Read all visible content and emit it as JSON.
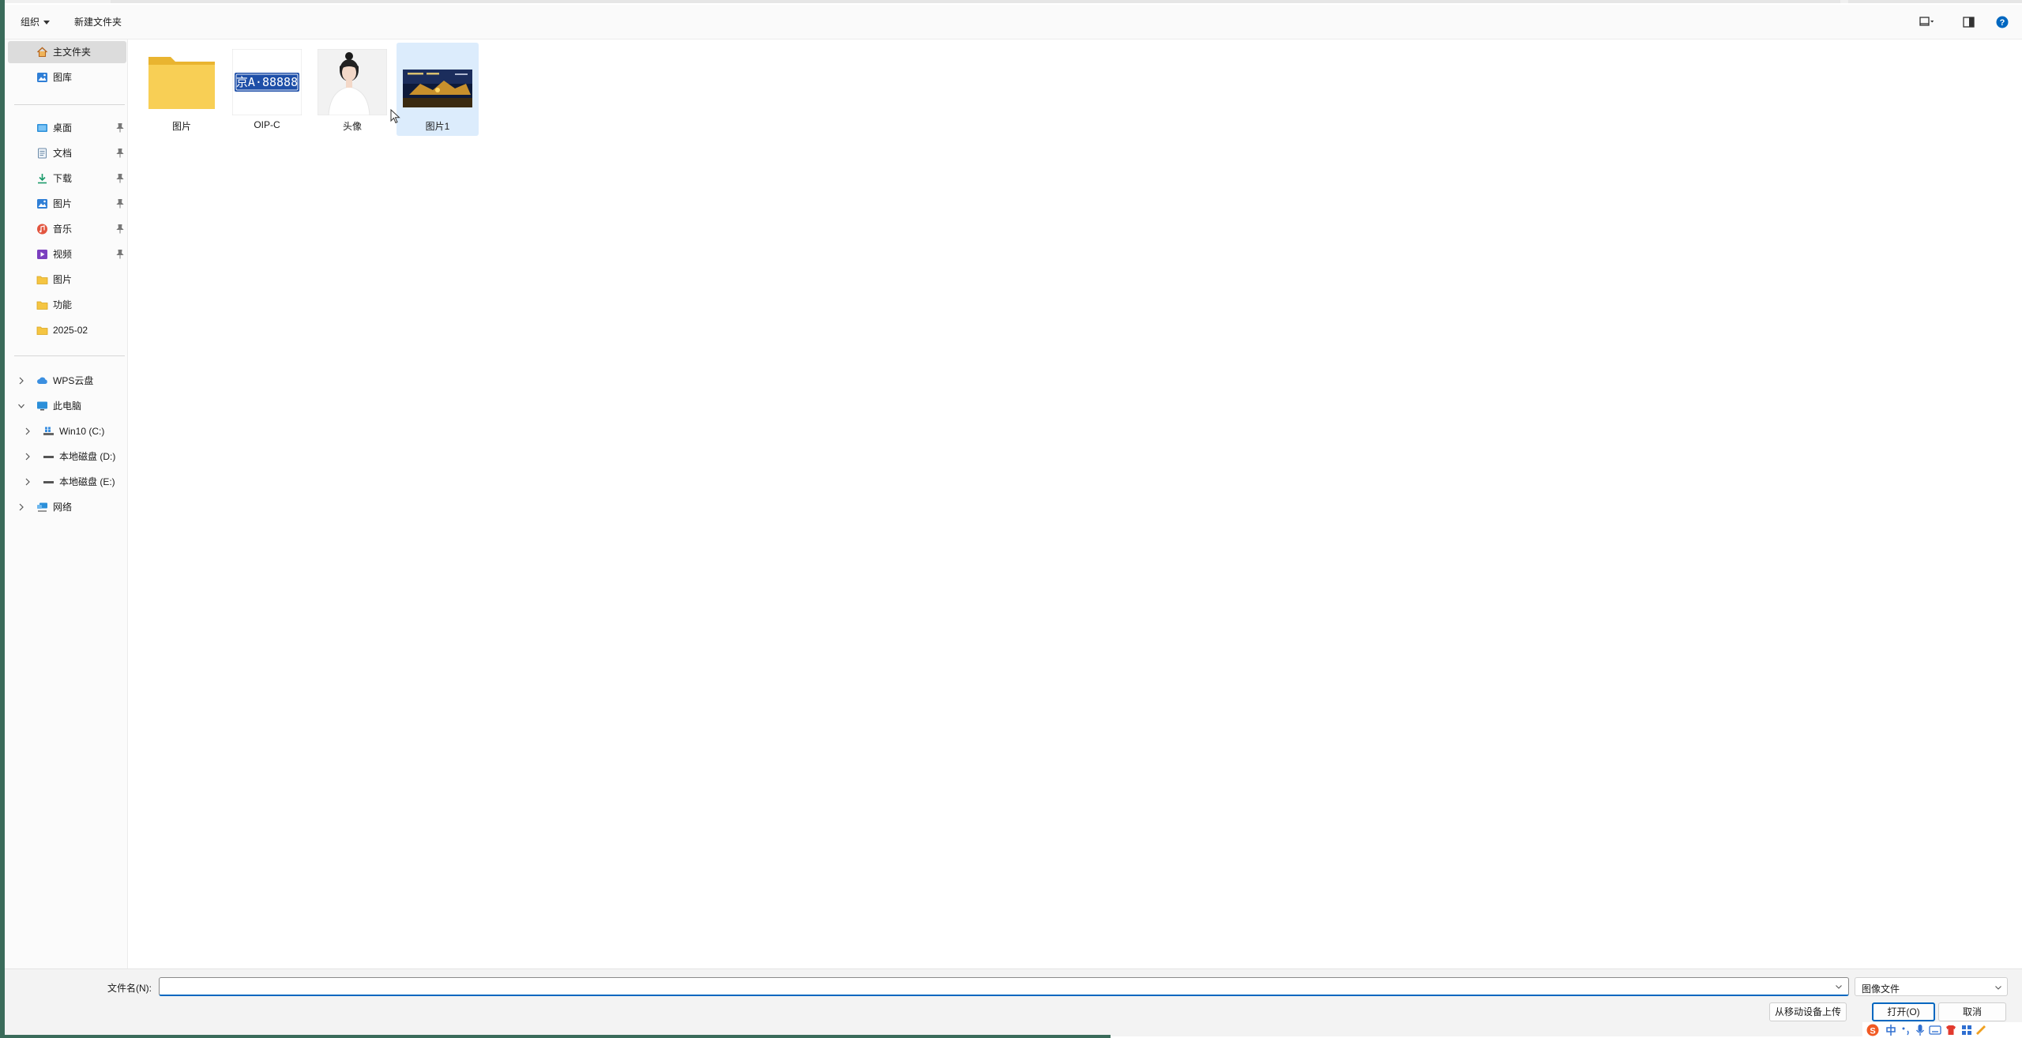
{
  "toolbar": {
    "organize_label": "组织",
    "new_folder_label": "新建文件夹"
  },
  "sidebar": {
    "home": "主文件夹",
    "gallery": "图库",
    "quick_access": [
      {
        "label": "桌面",
        "icon": "desktop-icon",
        "pinned": true
      },
      {
        "label": "文档",
        "icon": "document-icon",
        "pinned": true
      },
      {
        "label": "下载",
        "icon": "download-icon",
        "pinned": true
      },
      {
        "label": "图片",
        "icon": "pictures-icon",
        "pinned": true
      },
      {
        "label": "音乐",
        "icon": "music-icon",
        "pinned": true
      },
      {
        "label": "视频",
        "icon": "video-icon",
        "pinned": true
      },
      {
        "label": "图片",
        "icon": "folder-icon",
        "pinned": false
      },
      {
        "label": "功能",
        "icon": "folder-icon",
        "pinned": false
      },
      {
        "label": "2025-02",
        "icon": "folder-icon",
        "pinned": false
      }
    ],
    "tree": [
      {
        "label": "WPS云盘",
        "icon": "cloud-icon",
        "expanded": false
      },
      {
        "label": "此电脑",
        "icon": "computer-icon",
        "expanded": true
      },
      {
        "label": "Win10 (C:)",
        "icon": "windows-drive-icon",
        "expanded": false
      },
      {
        "label": "本地磁盘 (D:)",
        "icon": "drive-icon",
        "expanded": false
      },
      {
        "label": "本地磁盘 (E:)",
        "icon": "drive-icon",
        "expanded": false
      },
      {
        "label": "网络",
        "icon": "network-icon",
        "expanded": false
      }
    ]
  },
  "files": [
    {
      "name": "图片",
      "kind": "folder"
    },
    {
      "name": "OIP-C",
      "kind": "image-plate",
      "plate_text": "京A·88888"
    },
    {
      "name": "头像",
      "kind": "image-portrait"
    },
    {
      "name": "图片1",
      "kind": "image-night",
      "selected": true
    }
  ],
  "footer": {
    "filename_label": "文件名(N):",
    "filename_value": "",
    "file_type": "图像文件",
    "upload_label": "从移动设备上传",
    "open_label": "打开(O)",
    "cancel_label": "取消"
  },
  "colors": {
    "accent": "#0067c0",
    "selected_tile": "#dcecfc",
    "folder_yellow": "#f5c542"
  }
}
